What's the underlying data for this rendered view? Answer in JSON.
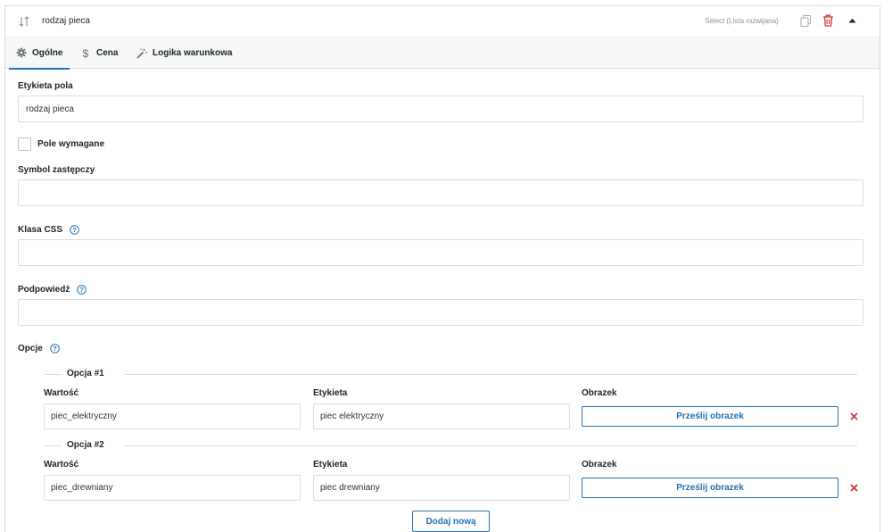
{
  "header": {
    "title": "rodzaj pieca",
    "field_type": "Select (Lista rozwijana)",
    "icons": [
      "sort-icon",
      "duplicate-icon",
      "trash-icon",
      "collapse-arrow-icon"
    ]
  },
  "tabs": [
    {
      "label": "Ogólne",
      "icon": "gear-icon",
      "active": true
    },
    {
      "label": "Cena",
      "icon": "dollar-icon",
      "active": false
    },
    {
      "label": "Logika warunkowa",
      "icon": "magic-wand-icon",
      "active": false
    }
  ],
  "form": {
    "field_label": {
      "label": "Etykieta pola",
      "value": "rodzaj pieca"
    },
    "required": {
      "label": "Pole wymagane",
      "checked": false
    },
    "placeholder": {
      "label": "Symbol zastępczy",
      "value": ""
    },
    "css_class": {
      "label": "Klasa CSS",
      "value": ""
    },
    "tooltip": {
      "label": "Podpowiedź",
      "value": ""
    },
    "options_label": "Opcje"
  },
  "options": [
    {
      "legend": "Opcja #1",
      "value_label": "Wartość",
      "value": "piec_elektryczny",
      "label_label": "Etykieta",
      "label": "piec elektryczny",
      "image_label": "Obrazek",
      "upload_button": "Prześlij obrazek"
    },
    {
      "legend": "Opcja #2",
      "value_label": "Wartość",
      "value": "piec_drewniany",
      "label_label": "Etykieta",
      "label": "piec drewniany",
      "image_label": "Obrazek",
      "upload_button": "Prześlij obrazek"
    }
  ],
  "add_button": "Dodaj nową",
  "colors": {
    "accent": "#2271b1",
    "danger": "#d63638",
    "border": "#dcdcde"
  }
}
